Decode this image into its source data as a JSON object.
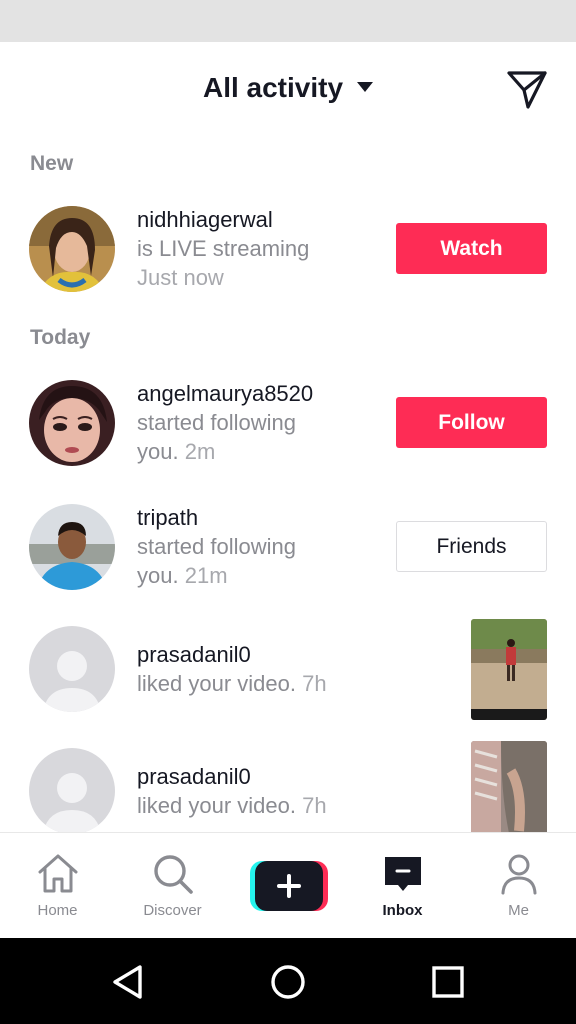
{
  "header": {
    "title": "All activity"
  },
  "sections": {
    "new_label": "New",
    "today_label": "Today"
  },
  "notifications": [
    {
      "username": "nidhhiagerwal",
      "line2": "is LIVE streaming",
      "line3": "Just now",
      "action_label": "Watch"
    },
    {
      "username": "angelmaurya8520",
      "line2": "started following",
      "line3_prefix": "you.",
      "line3_time": "2m",
      "action_label": "Follow"
    },
    {
      "username": "tripath",
      "line2": "started following",
      "line3_prefix": "you.",
      "line3_time": "21m",
      "action_label": "Friends"
    },
    {
      "username": "prasadanil0",
      "line2_prefix": "liked your video.",
      "line2_time": "7h"
    },
    {
      "username": "prasadanil0",
      "line2_prefix": "liked your video.",
      "line2_time": "7h"
    }
  ],
  "bottom_nav": {
    "items": [
      {
        "label": "Home",
        "icon": "home-icon"
      },
      {
        "label": "Discover",
        "icon": "search-icon"
      },
      {
        "label": "",
        "icon": "plus-icon"
      },
      {
        "label": "Inbox",
        "icon": "inbox-icon",
        "active": true
      },
      {
        "label": "Me",
        "icon": "profile-icon"
      }
    ]
  },
  "colors": {
    "accent": "#fe2c55",
    "text": "#161823",
    "muted": "#8a8b91"
  }
}
